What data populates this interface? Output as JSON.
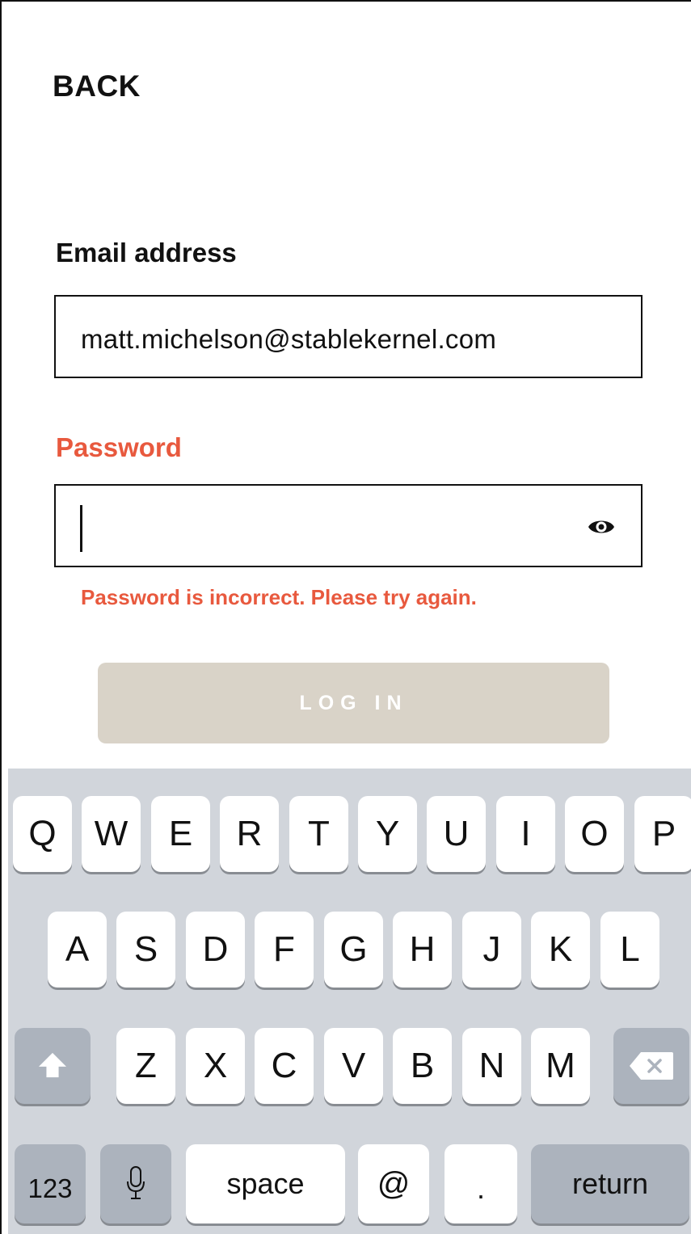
{
  "header": {
    "back_label": "BACK"
  },
  "form": {
    "email_label": "Email address",
    "email_value": "matt.michelson@stablekernel.com",
    "password_label": "Password",
    "password_value": "",
    "error_message": "Password is incorrect. Please try again.",
    "login_label": "LOG IN"
  },
  "colors": {
    "error": "#e8593e",
    "login_disabled": "#d9d3c8",
    "keyboard_bg": "#d1d5db",
    "key_dark": "#acb3bd"
  },
  "icons": {
    "password_toggle": "eye-icon",
    "shift": "shift-arrow-icon",
    "delete": "backspace-icon",
    "dictation": "microphone-icon"
  },
  "keyboard": {
    "row1": [
      "Q",
      "W",
      "E",
      "R",
      "T",
      "Y",
      "U",
      "I",
      "O",
      "P"
    ],
    "row2": [
      "A",
      "S",
      "D",
      "F",
      "G",
      "H",
      "J",
      "K",
      "L"
    ],
    "row3": [
      "Z",
      "X",
      "C",
      "V",
      "B",
      "N",
      "M"
    ],
    "numbers_key": "123",
    "space_key": "space",
    "at_key": "@",
    "period_key": ".",
    "return_key": "return"
  }
}
